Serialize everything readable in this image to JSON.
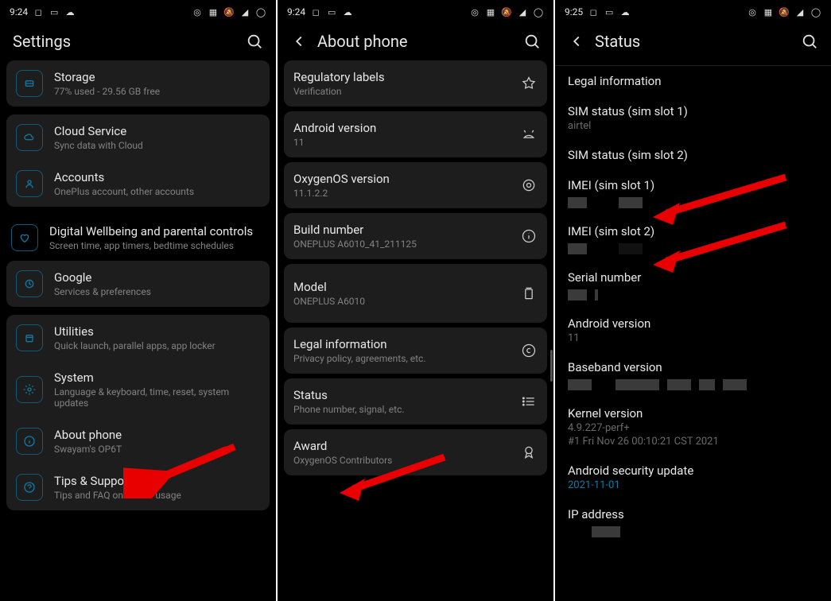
{
  "panel1": {
    "statusbar": {
      "time": "9:24"
    },
    "header": {
      "title": "Settings"
    },
    "items": {
      "storage": {
        "title": "Storage",
        "sub": "77% used - 29.56 GB free"
      },
      "cloud": {
        "title": "Cloud Service",
        "sub": "Sync data with Cloud"
      },
      "accounts": {
        "title": "Accounts",
        "sub": "OnePlus account, other accounts"
      },
      "wellbeing": {
        "title": "Digital Wellbeing and parental controls",
        "sub": "Screen time, app timers, bedtime schedules"
      },
      "google": {
        "title": "Google",
        "sub": "Services & preferences"
      },
      "utilities": {
        "title": "Utilities",
        "sub": "Quick launch, parallel apps, app locker"
      },
      "system": {
        "title": "System",
        "sub": "Language & keyboard, time, reset, system updates"
      },
      "about": {
        "title": "About phone",
        "sub": "Swayam's OP6T"
      },
      "tips": {
        "title": "Tips & Support",
        "sub": "Tips and FAQ on device usage"
      }
    }
  },
  "panel2": {
    "statusbar": {
      "time": "9:24"
    },
    "header": {
      "title": "About phone"
    },
    "items": {
      "regulatory": {
        "title": "Regulatory labels",
        "sub": "Verification"
      },
      "android": {
        "title": "Android version",
        "sub": "11"
      },
      "oxygen": {
        "title": "OxygenOS version",
        "sub": "11.1.2.2"
      },
      "build": {
        "title": "Build number",
        "sub": "ONEPLUS A6010_41_211125"
      },
      "model": {
        "title": "Model",
        "sub": "ONEPLUS A6010"
      },
      "legal": {
        "title": "Legal information",
        "sub": "Privacy policy, agreements, etc."
      },
      "status": {
        "title": "Status",
        "sub": "Phone number, signal, etc."
      },
      "award": {
        "title": "Award",
        "sub": "OxygenOS Contributors"
      }
    }
  },
  "panel3": {
    "statusbar": {
      "time": "9:25"
    },
    "header": {
      "title": "Status"
    },
    "items": {
      "legal": {
        "title": "Legal information"
      },
      "sim1": {
        "title": "SIM status (sim slot 1)",
        "sub": "airtel"
      },
      "sim2": {
        "title": "SIM status (sim slot 2)"
      },
      "imei1": {
        "title": "IMEI (sim slot 1)"
      },
      "imei2": {
        "title": "IMEI (sim slot 2)"
      },
      "serial": {
        "title": "Serial number"
      },
      "android": {
        "title": "Android version",
        "sub": "11"
      },
      "baseband": {
        "title": "Baseband version"
      },
      "kernel": {
        "title": "Kernel version",
        "sub1": "4.9.227-perf+",
        "sub2": "#1 Fri Nov 26 00:10:21 CST 2021"
      },
      "security": {
        "title": "Android security update",
        "sub": "2021-11-01"
      },
      "ip": {
        "title": "IP address"
      }
    }
  }
}
